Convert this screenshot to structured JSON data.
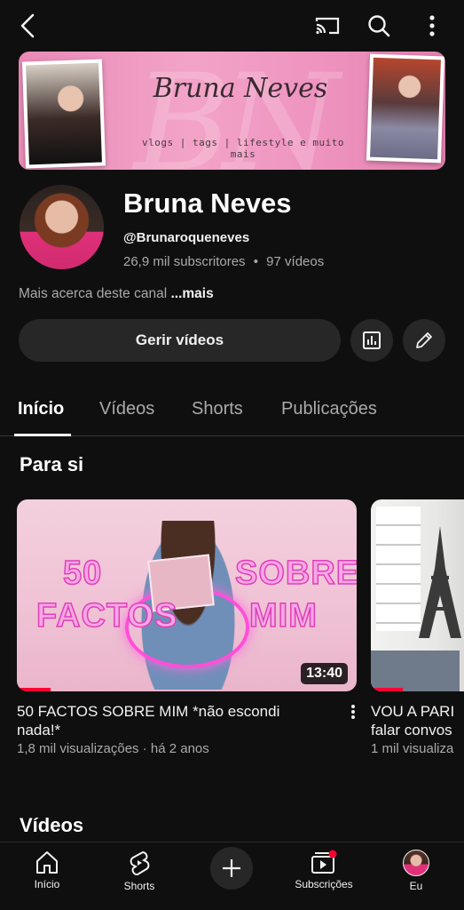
{
  "topbar": {
    "icons": [
      "back-arrow-icon",
      "cast-icon",
      "search-icon",
      "more-vert-icon"
    ]
  },
  "banner": {
    "script_title": "Bruna Neves",
    "tagline": "vlogs | tags | lifestyle e muito mais",
    "ghost_letters": "BN",
    "colors": {
      "background": "#f3a3c8"
    }
  },
  "channel": {
    "name": "Bruna Neves",
    "handle": "@Brunaroqueneves",
    "subscribers": "26,9 mil subscritores",
    "separator": "•",
    "videos": "97 vídeos",
    "about_text": "Mais acerca deste canal",
    "about_more": "...mais"
  },
  "actions": {
    "manage_label": "Gerir vídeos"
  },
  "tabs": [
    {
      "label": "Início",
      "active": true
    },
    {
      "label": "Vídeos",
      "active": false
    },
    {
      "label": "Shorts",
      "active": false
    },
    {
      "label": "Publicações",
      "active": false
    }
  ],
  "for_you": {
    "title": "Para si",
    "videos": [
      {
        "thumb_text_left_1": "50",
        "thumb_text_left_2": "FACTOS",
        "thumb_text_right_1": "SOBRE",
        "thumb_text_right_2": "MIM",
        "duration": "13:40",
        "progress": 0.1,
        "title": "50 FACTOS SOBRE MIM *não escondi nada!*",
        "meta": "1,8 mil visualizações · há 2 anos"
      },
      {
        "title": "VOU A PARI\nfalar convos",
        "title_line1": "VOU A PARI",
        "title_line2": "falar convos",
        "meta": "1 mil visualiza",
        "progress": 0.3
      }
    ]
  },
  "videos_section": {
    "title": "Vídeos"
  },
  "bottom_nav": [
    {
      "label": "Início",
      "icon": "home-icon"
    },
    {
      "label": "Shorts",
      "icon": "shorts-icon"
    },
    {
      "label": "",
      "icon": "create-plus-icon"
    },
    {
      "label": "Subscrições",
      "icon": "subscriptions-icon"
    },
    {
      "label": "Eu",
      "icon": "avatar"
    }
  ],
  "colors": {
    "accent": "#ff0033",
    "background": "#0f0f0f",
    "chip": "#272727",
    "muted_text": "#aaaaaa"
  }
}
